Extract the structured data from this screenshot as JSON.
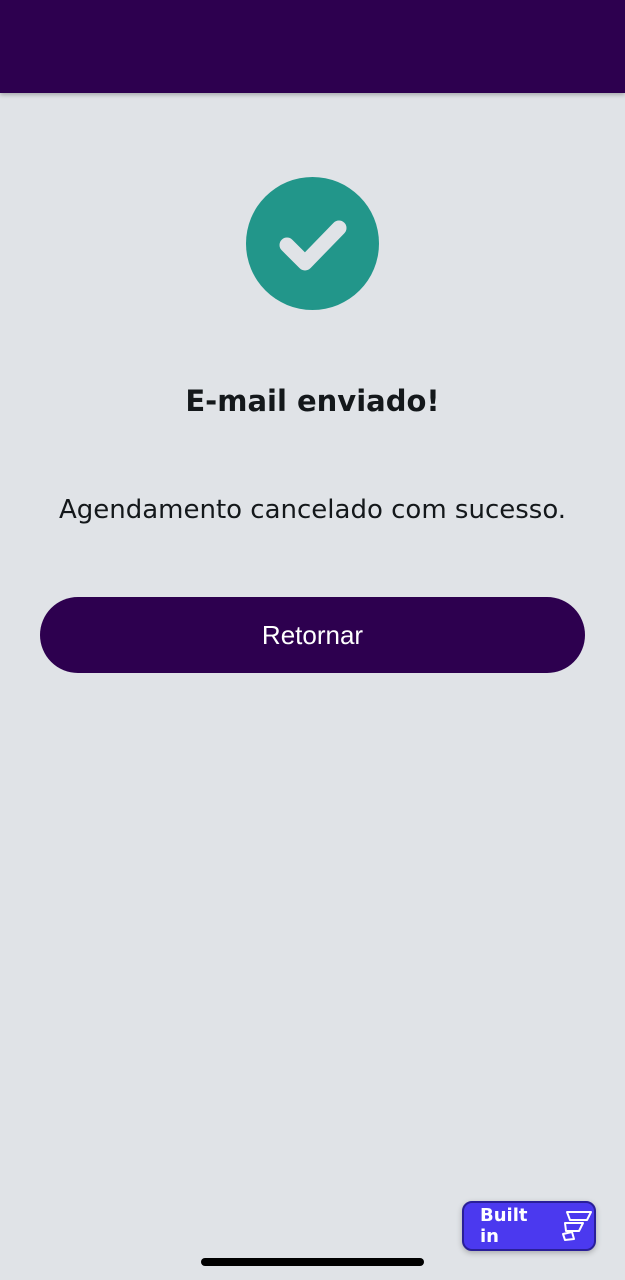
{
  "colors": {
    "app_bar": "#2D004F",
    "background": "#E0E3E7",
    "success": "#22968A",
    "primary_button": "#2D004F",
    "badge": "#4B39EF"
  },
  "status": {
    "icon": "check-icon",
    "title": "E-mail enviado!",
    "message": "Agendamento cancelado com sucesso."
  },
  "actions": {
    "return_label": "Retornar"
  },
  "badge": {
    "label": "Built in",
    "icon": "flutterflow-logo-icon"
  }
}
